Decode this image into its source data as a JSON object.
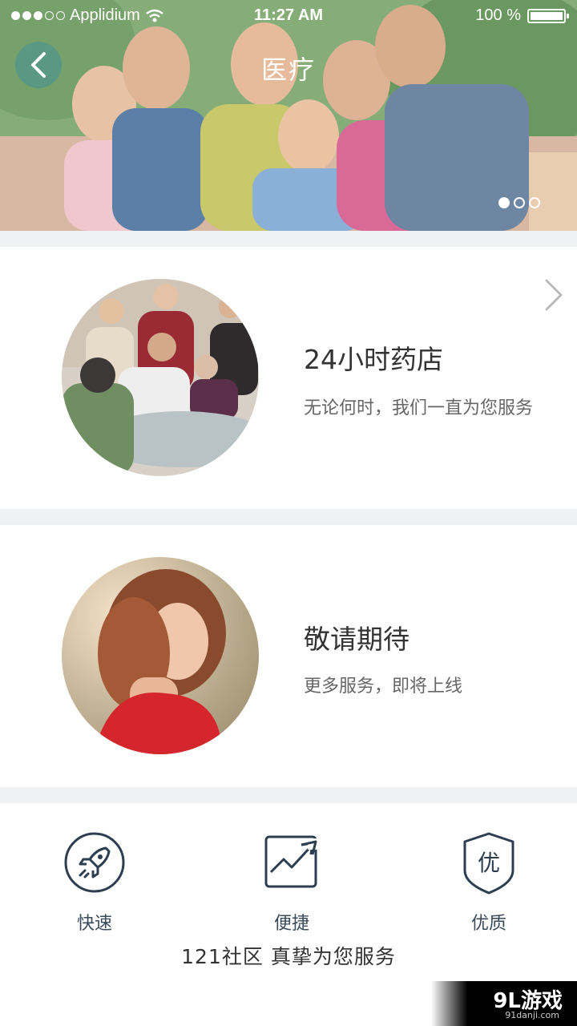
{
  "status_bar": {
    "carrier": "Applidium",
    "time": "11:27 AM",
    "battery": "100 %"
  },
  "header": {
    "title": "医疗",
    "back_icon": "chevron-left-icon",
    "pager": {
      "count": 3,
      "active": 1
    }
  },
  "services": [
    {
      "title": "24小时药店",
      "subtitle": "无论何时，我们一直为您服务",
      "image": "elderly-care-photo"
    },
    {
      "title": "敬请期待",
      "subtitle": "更多服务，即将上线",
      "image": "woman-portrait-photo"
    }
  ],
  "features": [
    {
      "label": "快速",
      "icon": "rocket-icon"
    },
    {
      "label": "便捷",
      "icon": "trend-chart-icon"
    },
    {
      "label": "优质",
      "icon": "shield-quality-icon",
      "glyph": "优"
    }
  ],
  "slogan": "121社区 真挚为您服务",
  "watermark": {
    "brand": "9L游戏",
    "url": "91danji.com"
  },
  "colors": {
    "accent": "#2d3e50",
    "back_button": "#5a9a90"
  }
}
